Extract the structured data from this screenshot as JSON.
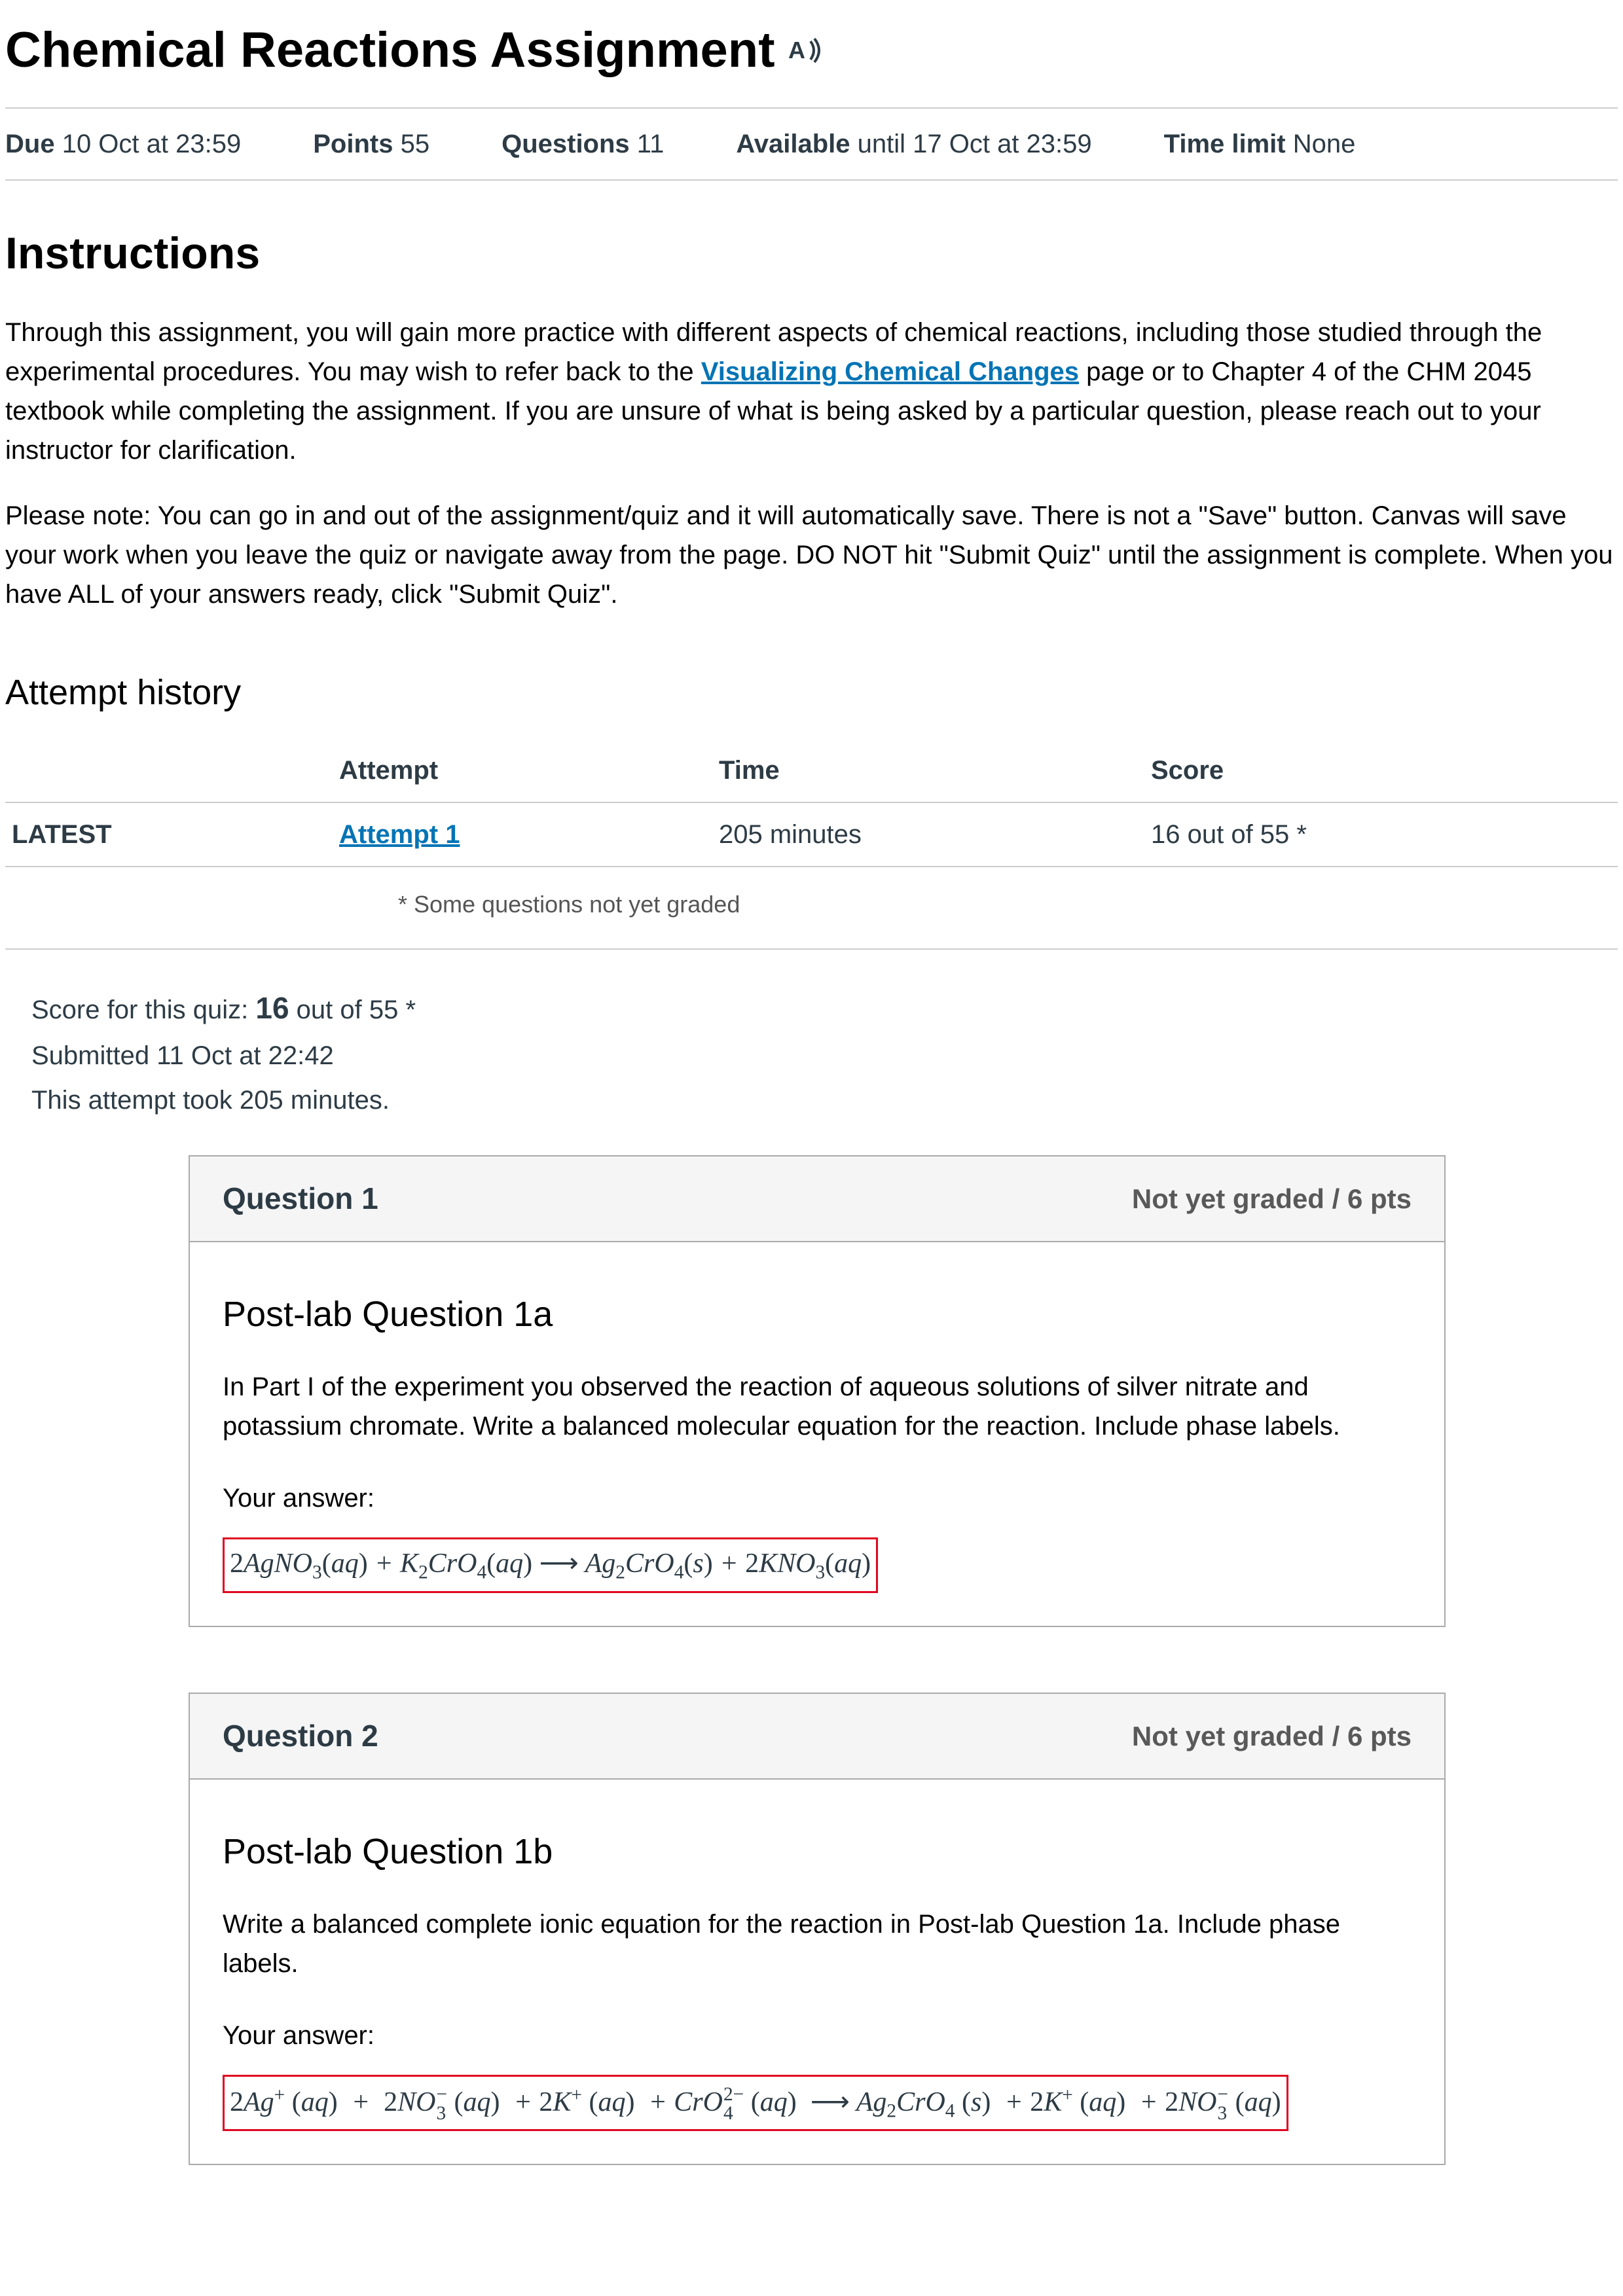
{
  "title": "Chemical Reactions Assignment",
  "meta": {
    "due_label": "Due",
    "due_value": "10 Oct at 23:59",
    "points_label": "Points",
    "points_value": "55",
    "questions_label": "Questions",
    "questions_value": "11",
    "available_label": "Available",
    "available_value": "until 17 Oct at 23:59",
    "timelimit_label": "Time limit",
    "timelimit_value": "None"
  },
  "instructions_heading": "Instructions",
  "instructions": {
    "p1a": "Through this assignment, you will gain more practice with different aspects of chemical reactions, including those studied through the experimental procedures. You may wish to refer back to the ",
    "link_text": "Visualizing Chemical Changes",
    "p1b": " page or to Chapter 4 of the CHM 2045 textbook while completing the assignment. If you are unsure of what is being asked by a particular question, please reach out to your instructor for clarification.",
    "p2": "Please note: You can go in and out of the assignment/quiz and it will automatically save. There is not a \"Save\" button. Canvas will save your work when you leave the quiz or navigate away from the page. DO NOT hit \"Submit Quiz\" until the assignment is complete. When you have ALL of your answers ready, click \"Submit Quiz\"."
  },
  "attempt_history_heading": "Attempt history",
  "history": {
    "col_attempt": "Attempt",
    "col_time": "Time",
    "col_score": "Score",
    "latest_label": "LATEST",
    "attempt_link": "Attempt 1",
    "time_value": "205 minutes",
    "score_value": "16 out of 55 *"
  },
  "footnote": "* Some questions not yet graded",
  "score_block": {
    "line1a": "Score for this quiz: ",
    "line1_num": "16",
    "line1b": " out of 55 *",
    "line2": "Submitted 11 Oct at 22:42",
    "line3": "This attempt took 205 minutes."
  },
  "q1": {
    "number": "Question 1",
    "pts": "Not yet graded / 6 pts",
    "subtitle": "Post-lab Question 1a",
    "text": "In Part I of the experiment you observed the reaction of aqueous solutions of silver nitrate and potassium chromate. Write a balanced molecular equation for the reaction. Include phase labels.",
    "your_answer": "Your answer:",
    "answer": "2AgNO₃(aq) + K₂CrO₄(aq) ⟶ Ag₂CrO₄(s) + 2KNO₃(aq)"
  },
  "q2": {
    "number": "Question 2",
    "pts": "Not yet graded / 6 pts",
    "subtitle": "Post-lab Question 1b",
    "text": "Write a balanced complete ionic equation for the reaction in Post-lab Question 1a. Include phase labels.",
    "your_answer": "Your answer:",
    "answer": "2Ag⁺ (aq) + 2NO₃⁻ (aq) + 2K⁺ (aq) + CrO₄²⁻ (aq) ⟶ Ag₂CrO₄ (s) + 2K⁺ (aq) + 2NO₃⁻ (aq)"
  }
}
